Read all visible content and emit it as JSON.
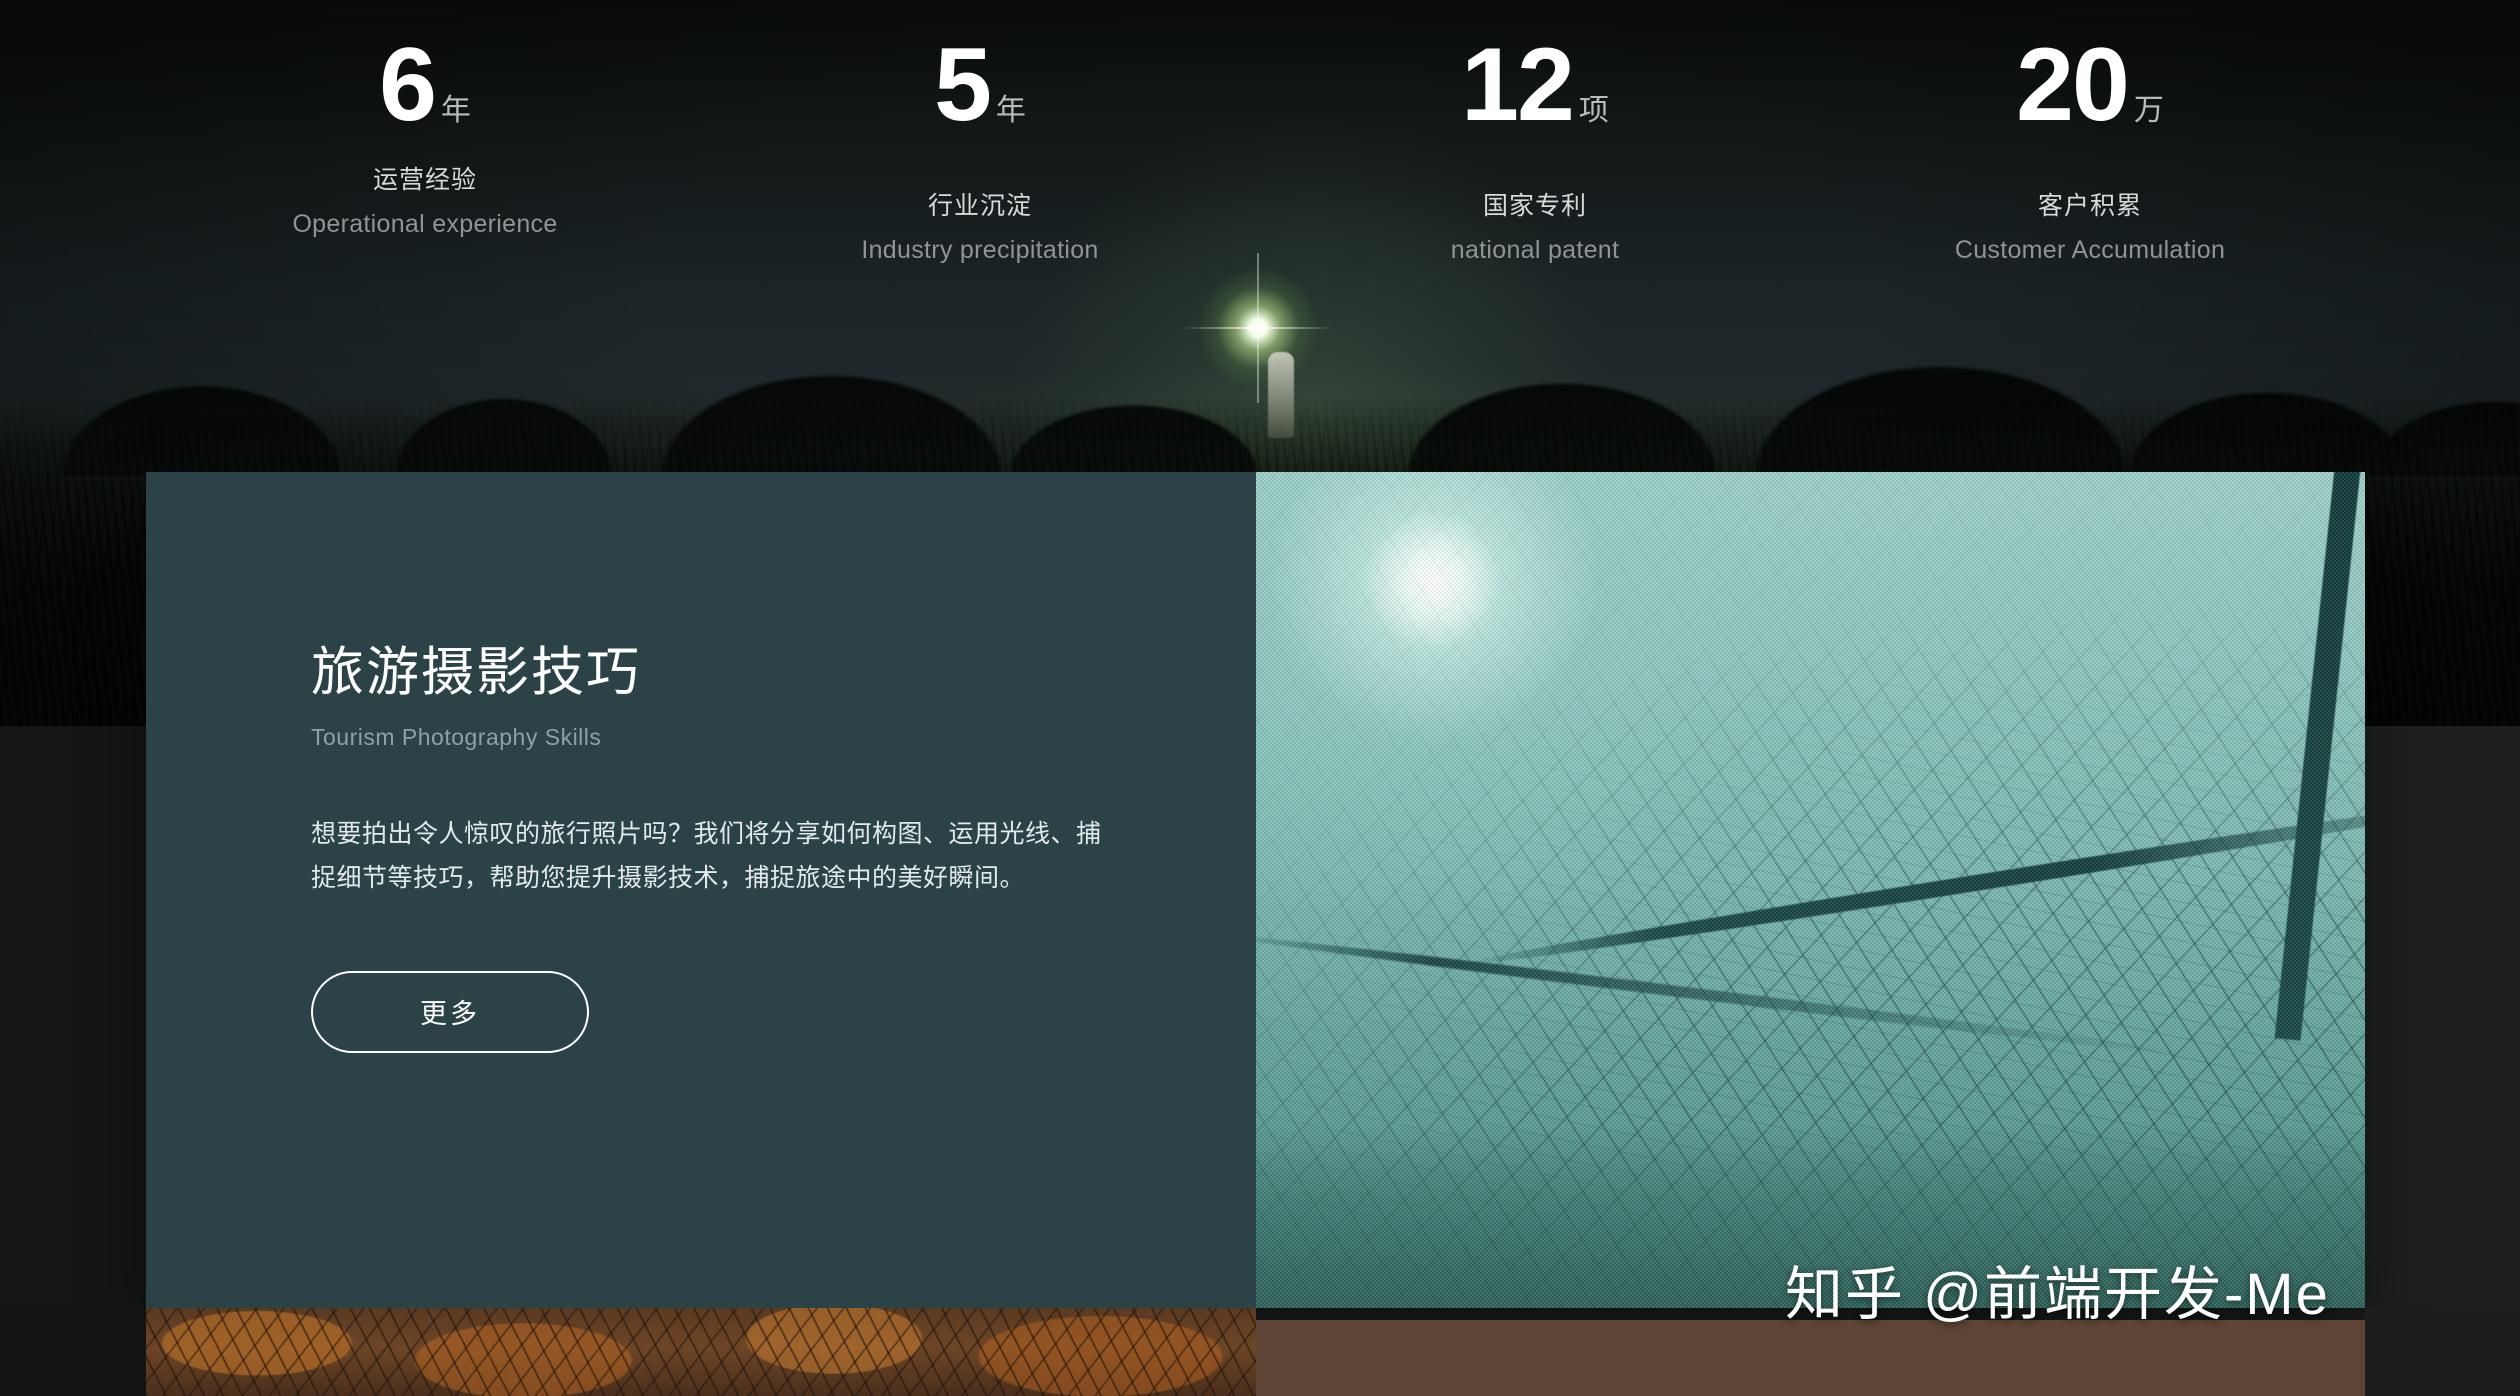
{
  "stats": [
    {
      "number": "6",
      "unit": "年",
      "label_cn": "运营经验",
      "label_en": "Operational experience"
    },
    {
      "number": "5",
      "unit": "年",
      "label_cn": "行业沉淀",
      "label_en": "Industry precipitation"
    },
    {
      "number": "12",
      "unit": "项",
      "label_cn": "国家专利",
      "label_en": "national patent"
    },
    {
      "number": "20",
      "unit": "万",
      "label_cn": "客户积累",
      "label_en": "Customer Accumulation"
    }
  ],
  "card": {
    "title": "旅游摄影技巧",
    "subtitle": "Tourism Photography Skills",
    "body": "想要拍出令人惊叹的旅行照片吗？我们将分享如何构图、运用光线、捕捉细节等技巧，帮助您提升摄影技术，捕捉旅途中的美好瞬间。",
    "more_label": "更多",
    "panel_color": "#2b4247",
    "photo_alt": "misty-forest-photo"
  },
  "hero": {
    "alt": "night-field-with-torch-photo"
  },
  "bottom": {
    "autumn_alt": "autumn-branches-photo",
    "panel_color": "#5d4435"
  },
  "watermark": {
    "text": "知乎 @前端开发-Me"
  },
  "colors": {
    "page_background": "#1a1c1c",
    "card_panel": "#2b4247",
    "accent_white": "#ffffff",
    "muted_text": "#8f9496"
  }
}
